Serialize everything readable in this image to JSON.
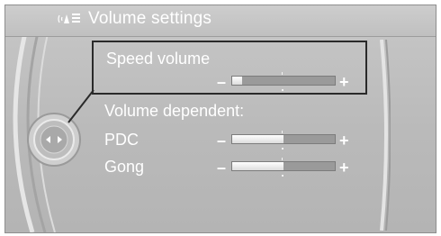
{
  "header": {
    "title": "Volume settings",
    "icon": "speaker-settings-icon"
  },
  "menu": {
    "speed_volume": {
      "label": "Speed volume",
      "minus": "–",
      "plus": "+",
      "level": 0.1
    },
    "dependent_heading": "Volume dependent:",
    "pdc": {
      "label": "PDC",
      "minus": "–",
      "plus": "+",
      "level": 0.5
    },
    "gong": {
      "label": "Gong",
      "minus": "–",
      "plus": "+",
      "level": 0.5
    }
  },
  "colors": {
    "background": "#bcbcbc",
    "text": "#ffffff",
    "selection_frame": "#2a2a2a",
    "track": "#9a9a9a"
  }
}
